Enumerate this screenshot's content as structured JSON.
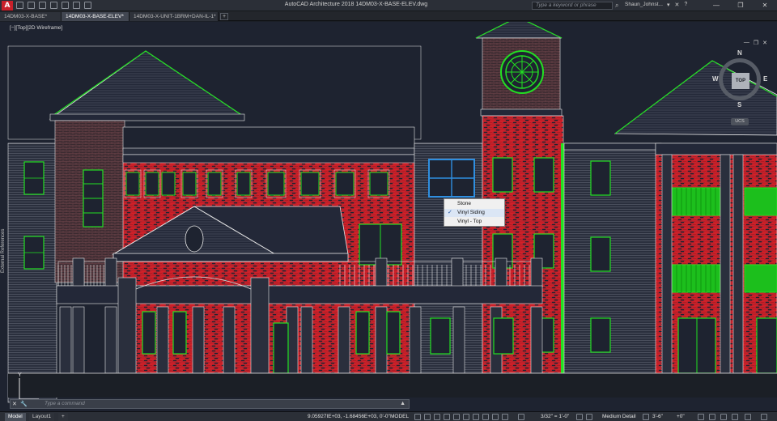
{
  "app": {
    "title": "AutoCAD Architecture 2018    14DM03-X-BASE-ELEV.dwg",
    "logo": "A",
    "search_placeholder": "Type a keyword or phrase",
    "user": "Shaun_Johnst...",
    "window_controls": [
      "—",
      "❐",
      "✕"
    ]
  },
  "tabs": [
    {
      "label": "14DM03-X-BASE*",
      "active": false
    },
    {
      "label": "14DM03-X-BASE-ELEV*",
      "active": true
    },
    {
      "label": "14DM03-X-UNIT-1BRM+DAN-IL-1*",
      "active": false
    }
  ],
  "tab_add": "+",
  "viewport": {
    "label": "[−][Top][2D Wireframe]",
    "controls": [
      "—",
      "❐",
      "✕"
    ]
  },
  "side_palette": {
    "label": "External References"
  },
  "viewcube": {
    "face": "TOP",
    "north": "N",
    "east": "E",
    "west": "W",
    "south": "S",
    "ucs": "UCS"
  },
  "context_menu": {
    "items": [
      {
        "label": "Stone",
        "checked": false
      },
      {
        "label": "Vinyl Siding",
        "checked": true
      },
      {
        "label": "Vinyl - Top",
        "checked": false
      }
    ],
    "check_glyph": "✓"
  },
  "command_line": {
    "close": "✕",
    "tool": "🔧",
    "placeholder": "Type a command",
    "expand": "▲"
  },
  "ucs_icon": {
    "y_label": "Y"
  },
  "status": {
    "layout_tabs": [
      {
        "label": "Model",
        "active": true
      },
      {
        "label": "Layout1",
        "active": false
      }
    ],
    "add_layout": "+",
    "coordinates": "9.05927IE+03, -1.68456E+03, 0'-0\"",
    "model": "MODEL",
    "scale": "3/32\" = 1'-0\"",
    "detail": "Medium Detail",
    "elevation": "3'-6\"",
    "offset": "+0\""
  },
  "colors": {
    "background": "#1e2330",
    "brick": "#e2232b",
    "window_green": "#22e022",
    "outline": "#e8e8e8",
    "highlight_blue": "#2f8fe0"
  }
}
